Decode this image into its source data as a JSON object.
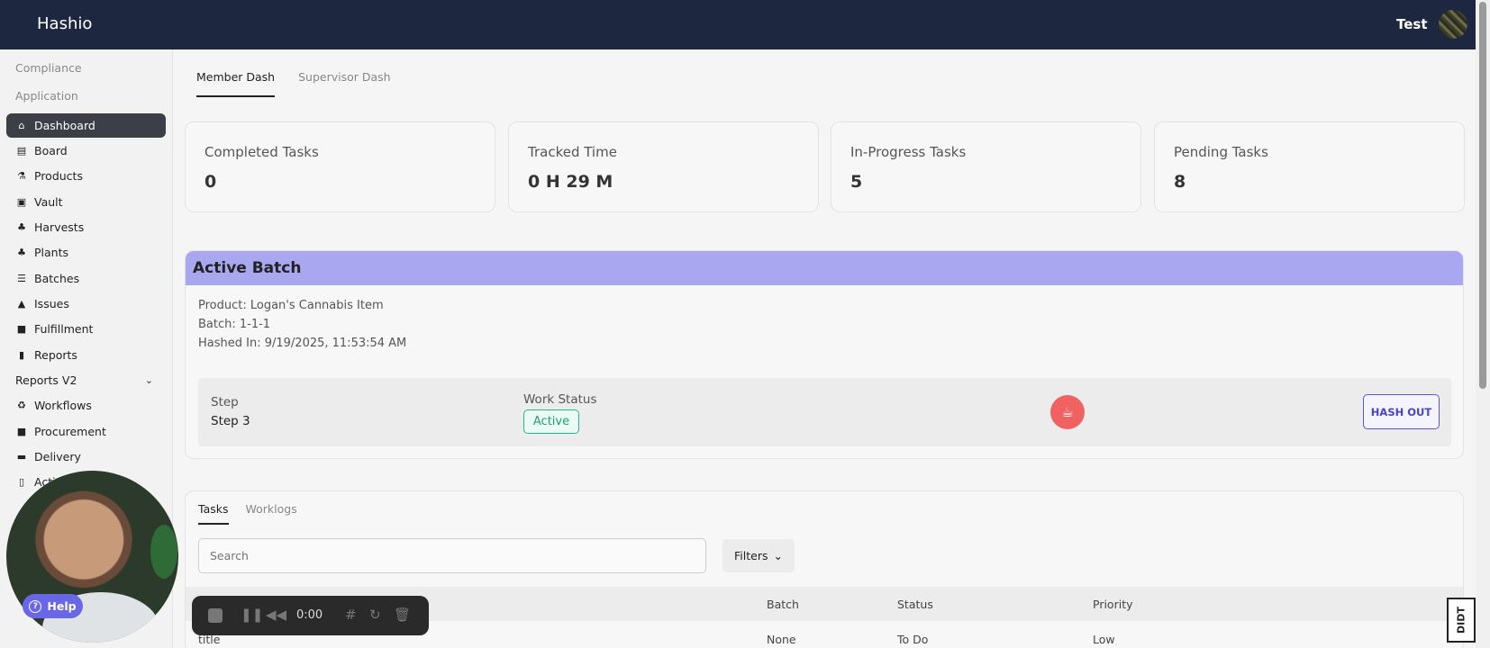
{
  "app": {
    "brand": "Hashio",
    "user_name": "Test"
  },
  "sidebar": {
    "sections": [
      "Compliance",
      "Application"
    ],
    "items": [
      {
        "label": "Dashboard",
        "icon": "home-icon",
        "active": true
      },
      {
        "label": "Board",
        "icon": "board-icon"
      },
      {
        "label": "Products",
        "icon": "flask-icon"
      },
      {
        "label": "Vault",
        "icon": "vault-icon"
      },
      {
        "label": "Harvests",
        "icon": "sprout-icon"
      },
      {
        "label": "Plants",
        "icon": "sprout-icon"
      },
      {
        "label": "Batches",
        "icon": "layers-icon"
      },
      {
        "label": "Issues",
        "icon": "warning-icon"
      },
      {
        "label": "Fulfillment",
        "icon": "box-icon"
      },
      {
        "label": "Reports",
        "icon": "bar-chart-icon"
      },
      {
        "label": "Reports V2",
        "icon": "chevron-down-icon"
      },
      {
        "label": "Workflows",
        "icon": "recycle-icon"
      },
      {
        "label": "Procurement",
        "icon": "bag-icon"
      },
      {
        "label": "Delivery",
        "icon": "truck-icon"
      },
      {
        "label": "Acti",
        "icon": "clipboard-icon"
      }
    ]
  },
  "dash_tabs": [
    {
      "label": "Member Dash",
      "active": true
    },
    {
      "label": "Supervisor Dash",
      "active": false
    }
  ],
  "stats": [
    {
      "label": "Completed Tasks",
      "value": "0"
    },
    {
      "label": "Tracked Time",
      "value": "0 H 29 M"
    },
    {
      "label": "In-Progress Tasks",
      "value": "5"
    },
    {
      "label": "Pending Tasks",
      "value": "8"
    }
  ],
  "active_batch": {
    "title": "Active Batch",
    "product": "Product: Logan's Cannabis Item",
    "batch": "Batch: 1-1-1",
    "hashed_in": "Hashed In: 9/19/2025, 11:53:54 AM",
    "step_label": "Step",
    "step_value": "Step 3",
    "work_status_label": "Work Status",
    "work_status": "Active",
    "break_icon": "coffee-icon",
    "hash_out_label": "HASH OUT"
  },
  "tasks": {
    "tabs": [
      {
        "label": "Tasks",
        "active": true
      },
      {
        "label": "Worklogs",
        "active": false
      }
    ],
    "search_placeholder": "Search",
    "filters_label": "Filters",
    "columns": [
      "Batch",
      "Status",
      "Priority"
    ],
    "rows": [
      {
        "title": "title",
        "batch": "None",
        "status": "To Do",
        "priority": "Low"
      }
    ]
  },
  "overlay": {
    "help_label": "Help",
    "recorder_time": "0:00",
    "corner_badge": "DIDT"
  },
  "colors": {
    "topbar": "#1d2740",
    "batch_header": "#a9a7f0",
    "active_green": "#1fa07a",
    "accent_purple": "#5b55d6",
    "break_red": "#f06262"
  }
}
